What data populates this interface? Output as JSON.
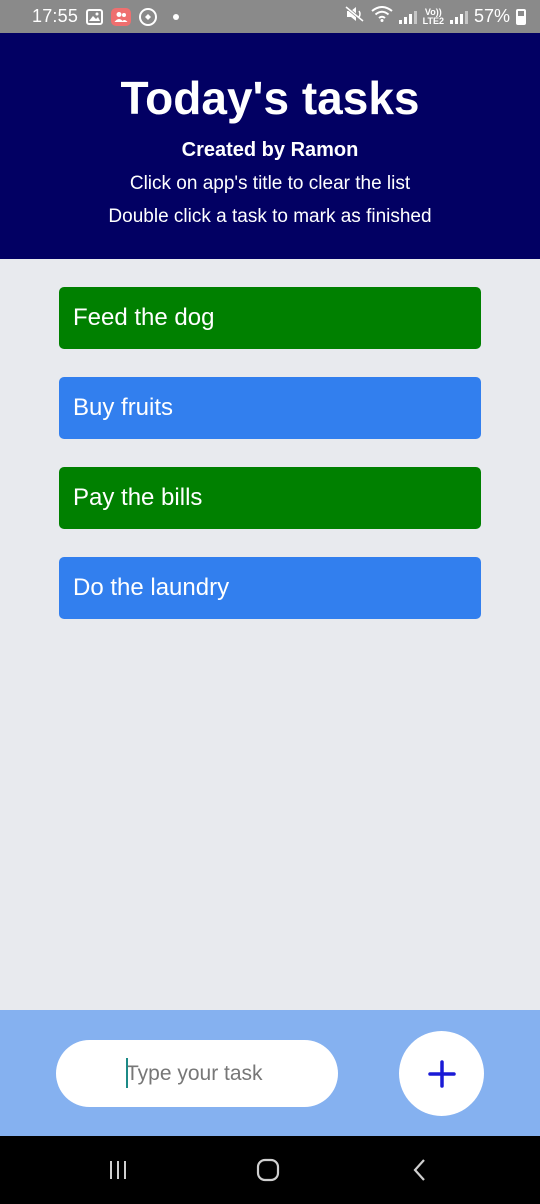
{
  "status_bar": {
    "time": "17:55",
    "battery": "57%",
    "volte": "Vo))",
    "lte": "LTE2",
    "left_icons": [
      "gallery-icon",
      "people-icon",
      "circle-icon",
      "dot-icon"
    ],
    "right_icons": [
      "mute-icon",
      "wifi-icon",
      "signal-icon",
      "signal-icon",
      "battery-icon"
    ]
  },
  "header": {
    "title": "Today's tasks",
    "author": "Created by Ramon",
    "hint_clear": "Click on app's title to clear the list",
    "hint_finish": "Double click a task to mark as finished",
    "background": "#020063"
  },
  "tasks": [
    {
      "label": "Feed the dog",
      "finished": true
    },
    {
      "label": "Buy fruits",
      "finished": false
    },
    {
      "label": "Pay the bills",
      "finished": true
    },
    {
      "label": "Do the laundry",
      "finished": false
    }
  ],
  "colors": {
    "finished": "#008000",
    "pending": "#327fee",
    "input_bar": "#85b1f0",
    "plus": "#1a1ad6"
  },
  "input": {
    "placeholder": "Type your task",
    "value": ""
  },
  "add_button": {
    "icon": "plus-icon"
  },
  "nav_bar": {
    "icons": [
      "recent-apps-icon",
      "home-icon",
      "back-icon"
    ]
  }
}
